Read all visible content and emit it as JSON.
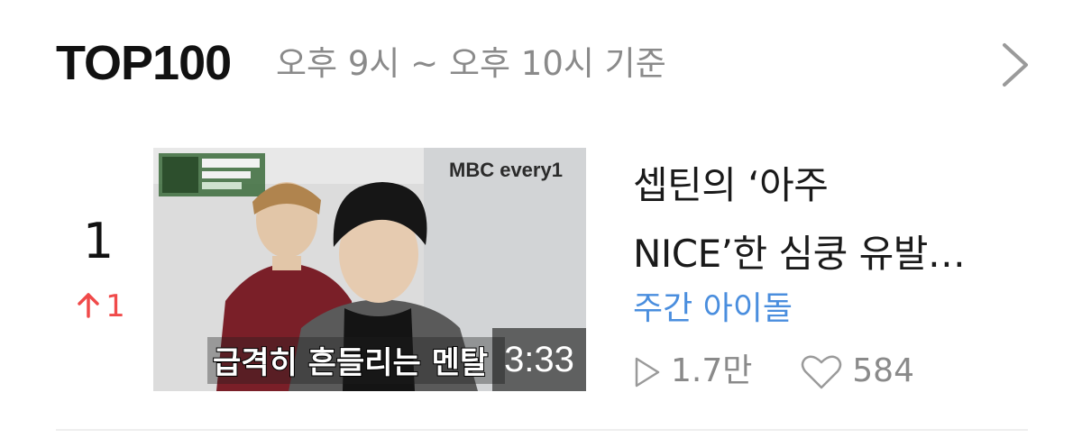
{
  "header": {
    "title": "TOP100",
    "subtitle": "오후 9시 ~ 오후 10시 기준",
    "more_icon": "chevron-right-icon"
  },
  "items": [
    {
      "rank": "1",
      "rank_change": "1",
      "rank_change_direction": "up",
      "rank_change_icon": "arrow-up-icon",
      "thumbnail": {
        "broadcaster_logo": "MBC every1",
        "caption": "급격히 흔들리는 멘탈",
        "duration": "3:33"
      },
      "title_line1": "셉틴의 ‘아주",
      "title_line2": "NICE’한 심쿵 유발…",
      "channel": "주간 아이돌",
      "views": "1.7만",
      "views_icon": "play-icon",
      "likes": "584",
      "likes_icon": "heart-icon"
    }
  ],
  "colors": {
    "rank_up": "#f04a4a",
    "channel_link": "#4a8ede",
    "muted_text": "#8a8a8a",
    "divider": "#eeeeee"
  }
}
